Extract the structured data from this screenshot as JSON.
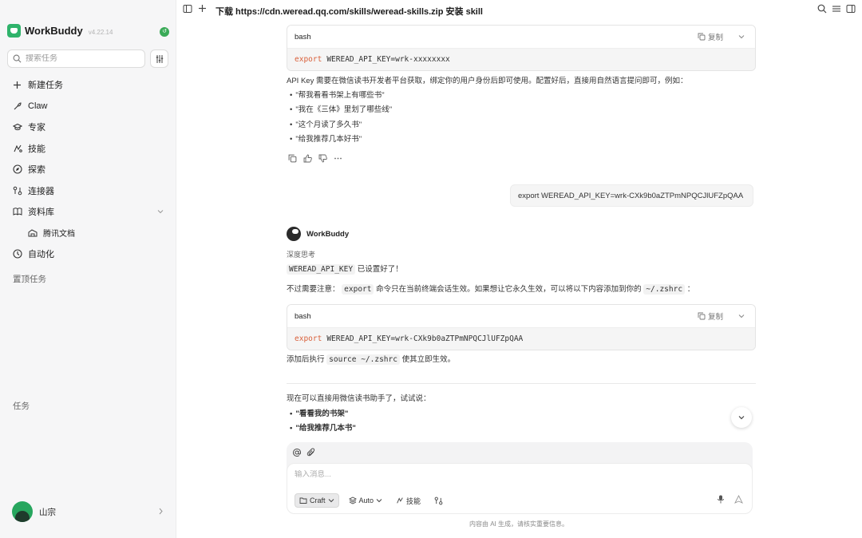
{
  "sidebar": {
    "app_name": "WorkBuddy",
    "version": "v4.22.14",
    "sync_badge": "↺",
    "search_placeholder": "搜索任务",
    "nav": [
      {
        "label": "新建任务",
        "icon": "plus-icon"
      },
      {
        "label": "Claw",
        "icon": "claw-icon"
      },
      {
        "label": "专家",
        "icon": "expert-icon"
      },
      {
        "label": "技能",
        "icon": "skill-icon"
      },
      {
        "label": "探索",
        "icon": "compass-icon"
      },
      {
        "label": "连接器",
        "icon": "connector-icon"
      },
      {
        "label": "资料库",
        "icon": "book-icon"
      },
      {
        "label": "腾讯文档",
        "icon": "docs-icon"
      },
      {
        "label": "自动化",
        "icon": "clock-icon"
      }
    ],
    "pinned_label": "置顶任务",
    "tasks_label": "任务",
    "user_name": "山宗"
  },
  "topbar": {
    "title": "下载 https://cdn.weread.qq.com/skills/weread-skills.zip 安装 skill"
  },
  "chat": {
    "code1": {
      "lang": "bash",
      "copy_label": "复制",
      "keyword": "export",
      "rest": "WEREAD_API_KEY=wrk-xxxxxxxx"
    },
    "intro": "API Key 需要在微信读书开发者平台获取，绑定你的用户身份后即可使用。配置好后，直接用自然语言提问即可，例如：",
    "examples": [
      "\"帮我看看书架上有哪些书\"",
      "\"我在《三体》里划了哪些线\"",
      "\"这个月读了多久书\"",
      "\"给我推荐几本好书\""
    ],
    "user_message": "export WEREAD_API_KEY=wrk-CXk9b0aZTPmNPQCJlUFZpQAA",
    "bot_name": "WorkBuddy",
    "thinking_label": "深度思考",
    "set_ok_code": "WEREAD_API_KEY",
    "set_ok_text": "已设置好了！",
    "note_prefix": "不过需要注意：",
    "note_code": "export",
    "note_mid": "命令只在当前终端会话生效。如果想让它永久生效，可以将以下内容添加到你的",
    "note_file": "~/.zshrc",
    "note_suffix": "：",
    "code2": {
      "lang": "bash",
      "copy_label": "复制",
      "keyword": "export",
      "rest": "WEREAD_API_KEY=wrk-CXk9b0aZTPmNPQCJlUFZpQAA"
    },
    "after_prefix": "添加后执行",
    "after_code": "source ~/.zshrc",
    "after_suffix": "使其立即生效。",
    "now_text": "现在可以直接用微信读书助手了，试试说：",
    "try_items": [
      "\"看看我的书架\"",
      "\"给我推荐几本书\""
    ]
  },
  "composer": {
    "placeholder": "输入消息...",
    "mode_label": "Craft",
    "model_label": "Auto",
    "skill_label": "技能"
  },
  "footer_note": "内容由 AI 生成，请核实重要信息。"
}
